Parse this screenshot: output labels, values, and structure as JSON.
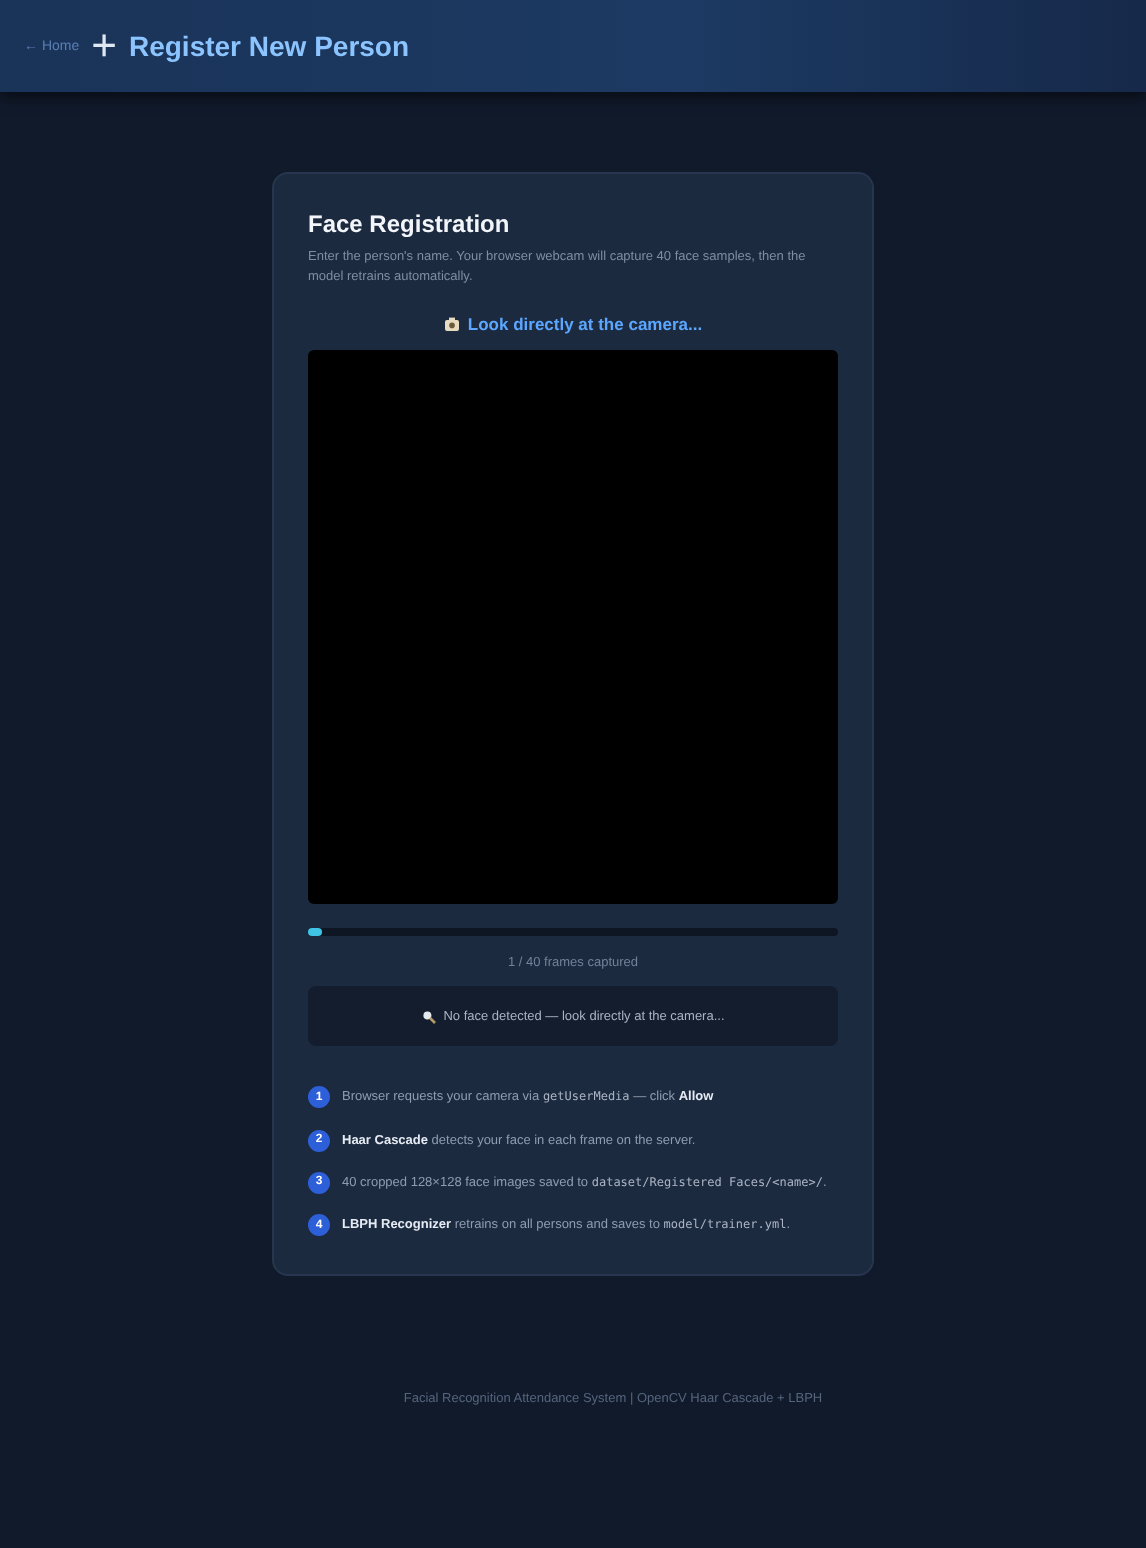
{
  "header": {
    "back_link": "← Home",
    "icon": "+",
    "title": "Register New Person"
  },
  "card": {
    "title": "Face Registration",
    "description": "Enter the person's name. Your browser webcam will capture 40 face samples, then the model retrains automatically.",
    "prompt": "Look directly at the camera...",
    "progress": {
      "level": 0.025,
      "label": "1 / 40 frames captured"
    },
    "status": "No face detected — look directly at the camera...",
    "steps": [
      {
        "number": "1",
        "parts": [
          {
            "kind": "text",
            "text": "Browser requests your camera via "
          },
          {
            "kind": "code",
            "text": "getUserMedia"
          },
          {
            "kind": "text",
            "text": " — click "
          },
          {
            "kind": "bold",
            "text": "Allow"
          }
        ]
      },
      {
        "number": "2",
        "parts": [
          {
            "kind": "bold",
            "text": "Haar Cascade"
          },
          {
            "kind": "text",
            "text": " detects your face in each frame on the server."
          }
        ]
      },
      {
        "number": "3",
        "parts": [
          {
            "kind": "text",
            "text": "40 cropped 128×128 face images saved to "
          },
          {
            "kind": "code",
            "text": "dataset/Registered Faces/<name>/"
          },
          {
            "kind": "text",
            "text": "."
          }
        ]
      },
      {
        "number": "4",
        "parts": [
          {
            "kind": "bold",
            "text": "LBPH Recognizer"
          },
          {
            "kind": "text",
            "text": " retrains on all persons and saves to "
          },
          {
            "kind": "code",
            "text": "model/trainer.yml"
          },
          {
            "kind": "text",
            "text": "."
          }
        ]
      }
    ]
  },
  "footer": "Facial Recognition Attendance System | OpenCV Haar Cascade + LBPH"
}
